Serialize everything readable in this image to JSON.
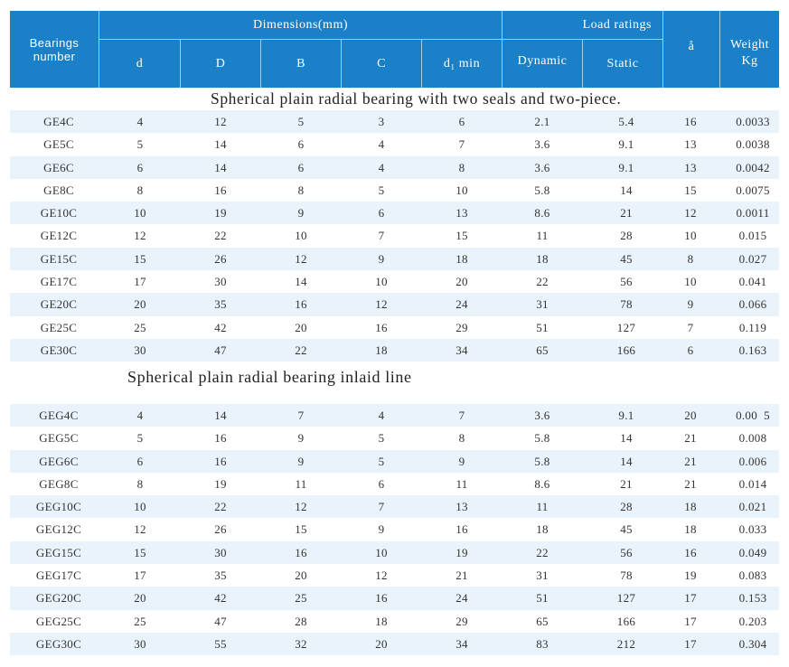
{
  "header": {
    "bearings_number": "Bearings\nnumber",
    "dimensions_group": "Dimensions(mm)",
    "load_ratings_group": "Load ratings",
    "columns": {
      "d": "d",
      "D": "D",
      "B": "B",
      "C": "C",
      "d1min": "d₁ min",
      "dynamic": "Dynamic",
      "static": "Static",
      "angle": "å",
      "weight": "Weight\nKg"
    }
  },
  "colors": {
    "header_bg": "#1a80c8",
    "header_divider": "#9dd0f2",
    "row_shade": "#e8f3fb",
    "text": "#333333"
  },
  "sections": [
    {
      "title": "Spherical plain radial bearing with two seals and two-piece.",
      "rows": [
        [
          "GE4C",
          "4",
          "12",
          "5",
          "3",
          "6",
          "2.1",
          "5.4",
          "16",
          "0.0033"
        ],
        [
          "GE5C",
          "5",
          "14",
          "6",
          "4",
          "7",
          "3.6",
          "9.1",
          "13",
          "0.0038"
        ],
        [
          "GE6C",
          "6",
          "14",
          "6",
          "4",
          "8",
          "3.6",
          "9.1",
          "13",
          "0.0042"
        ],
        [
          "GE8C",
          "8",
          "16",
          "8",
          "5",
          "10",
          "5.8",
          "14",
          "15",
          "0.0075"
        ],
        [
          "GE10C",
          "10",
          "19",
          "9",
          "6",
          "13",
          "8.6",
          "21",
          "12",
          "0.0011"
        ],
        [
          "GE12C",
          "12",
          "22",
          "10",
          "7",
          "15",
          "11",
          "28",
          "10",
          "0.015"
        ],
        [
          "GE15C",
          "15",
          "26",
          "12",
          "9",
          "18",
          "18",
          "45",
          "8",
          "0.027"
        ],
        [
          "GE17C",
          "17",
          "30",
          "14",
          "10",
          "20",
          "22",
          "56",
          "10",
          "0.041"
        ],
        [
          "GE20C",
          "20",
          "35",
          "16",
          "12",
          "24",
          "31",
          "78",
          "9",
          "0.066"
        ],
        [
          "GE25C",
          "25",
          "42",
          "20",
          "16",
          "29",
          "51",
          "127",
          "7",
          "0.119"
        ],
        [
          "GE30C",
          "30",
          "47",
          "22",
          "18",
          "34",
          "65",
          "166",
          "6",
          "0.163"
        ]
      ]
    },
    {
      "title": "Spherical plain radial bearing inlaid line",
      "rows": [
        [
          "GEG4C",
          "4",
          "14",
          "7",
          "4",
          "7",
          "3.6",
          "9.1",
          "20",
          "0.00  5"
        ],
        [
          "GEG5C",
          "5",
          "16",
          "9",
          "5",
          "8",
          "5.8",
          "14",
          "21",
          "0.008"
        ],
        [
          "GEG6C",
          "6",
          "16",
          "9",
          "5",
          "9",
          "5.8",
          "14",
          "21",
          "0.006"
        ],
        [
          "GEG8C",
          "8",
          "19",
          "11",
          "6",
          "11",
          "8.6",
          "21",
          "21",
          "0.014"
        ],
        [
          "GEG10C",
          "10",
          "22",
          "12",
          "7",
          "13",
          "11",
          "28",
          "18",
          "0.021"
        ],
        [
          "GEG12C",
          "12",
          "26",
          "15",
          "9",
          "16",
          "18",
          "45",
          "18",
          "0.033"
        ],
        [
          "GEG15C",
          "15",
          "30",
          "16",
          "10",
          "19",
          "22",
          "56",
          "16",
          "0.049"
        ],
        [
          "GEG17C",
          "17",
          "35",
          "20",
          "12",
          "21",
          "31",
          "78",
          "19",
          "0.083"
        ],
        [
          "GEG20C",
          "20",
          "42",
          "25",
          "16",
          "24",
          "51",
          "127",
          "17",
          "0.153"
        ],
        [
          "GEG25C",
          "25",
          "47",
          "28",
          "18",
          "29",
          "65",
          "166",
          "17",
          "0.203"
        ],
        [
          "GEG30C",
          "30",
          "55",
          "32",
          "20",
          "34",
          "83",
          "212",
          "17",
          "0.304"
        ]
      ]
    }
  ]
}
